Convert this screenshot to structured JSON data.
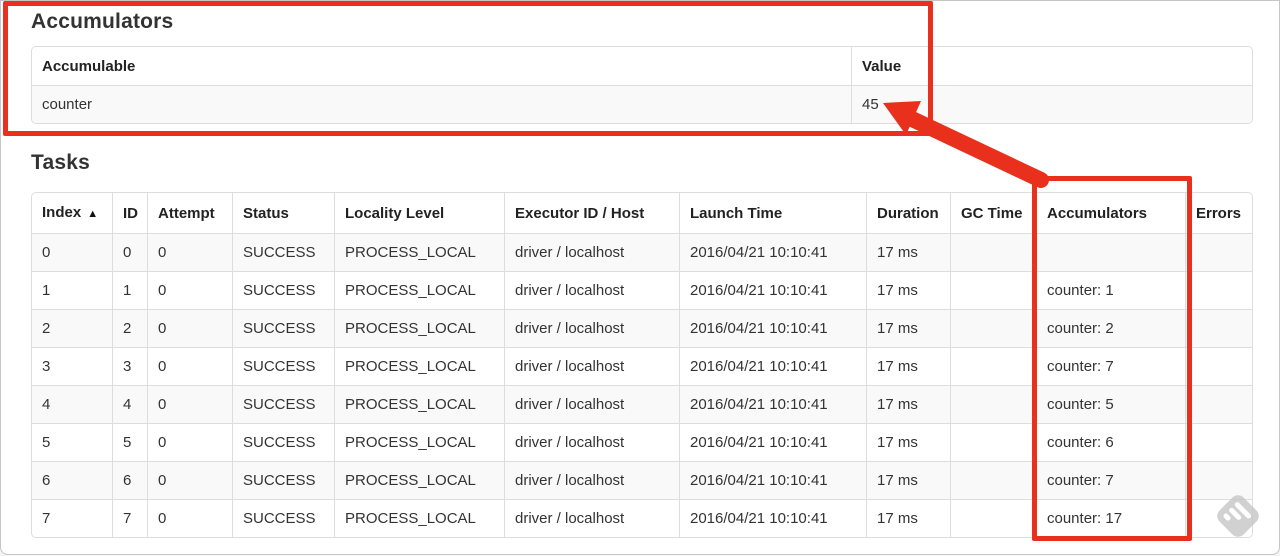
{
  "accumulators_section": {
    "title": "Accumulators",
    "table": {
      "headers": [
        "Accumulable",
        "Value"
      ],
      "rows": [
        [
          "counter",
          "45"
        ]
      ]
    }
  },
  "tasks_section": {
    "title": "Tasks",
    "table": {
      "headers": [
        "Index",
        "ID",
        "Attempt",
        "Status",
        "Locality Level",
        "Executor ID / Host",
        "Launch Time",
        "Duration",
        "GC Time",
        "Accumulators",
        "Errors"
      ],
      "sort_arrow": "▲",
      "rows": [
        [
          "0",
          "0",
          "0",
          "SUCCESS",
          "PROCESS_LOCAL",
          "driver / localhost",
          "2016/04/21 10:10:41",
          "17 ms",
          "",
          "",
          ""
        ],
        [
          "1",
          "1",
          "0",
          "SUCCESS",
          "PROCESS_LOCAL",
          "driver / localhost",
          "2016/04/21 10:10:41",
          "17 ms",
          "",
          "counter: 1",
          ""
        ],
        [
          "2",
          "2",
          "0",
          "SUCCESS",
          "PROCESS_LOCAL",
          "driver / localhost",
          "2016/04/21 10:10:41",
          "17 ms",
          "",
          "counter: 2",
          ""
        ],
        [
          "3",
          "3",
          "0",
          "SUCCESS",
          "PROCESS_LOCAL",
          "driver / localhost",
          "2016/04/21 10:10:41",
          "17 ms",
          "",
          "counter: 7",
          ""
        ],
        [
          "4",
          "4",
          "0",
          "SUCCESS",
          "PROCESS_LOCAL",
          "driver / localhost",
          "2016/04/21 10:10:41",
          "17 ms",
          "",
          "counter: 5",
          ""
        ],
        [
          "5",
          "5",
          "0",
          "SUCCESS",
          "PROCESS_LOCAL",
          "driver / localhost",
          "2016/04/21 10:10:41",
          "17 ms",
          "",
          "counter: 6",
          ""
        ],
        [
          "6",
          "6",
          "0",
          "SUCCESS",
          "PROCESS_LOCAL",
          "driver / localhost",
          "2016/04/21 10:10:41",
          "17 ms",
          "",
          "counter: 7",
          ""
        ],
        [
          "7",
          "7",
          "0",
          "SUCCESS",
          "PROCESS_LOCAL",
          "driver / localhost",
          "2016/04/21 10:10:41",
          "17 ms",
          "",
          "counter: 17",
          ""
        ]
      ]
    }
  },
  "annotations": {
    "color": "#e8301c",
    "boxed_regions": [
      "accumulators-section",
      "tasks-accumulators-column"
    ],
    "arrow_target_value": "45"
  },
  "watermark": {
    "icon": "diamond-stripes-icon",
    "color": "#c9c9c9"
  }
}
